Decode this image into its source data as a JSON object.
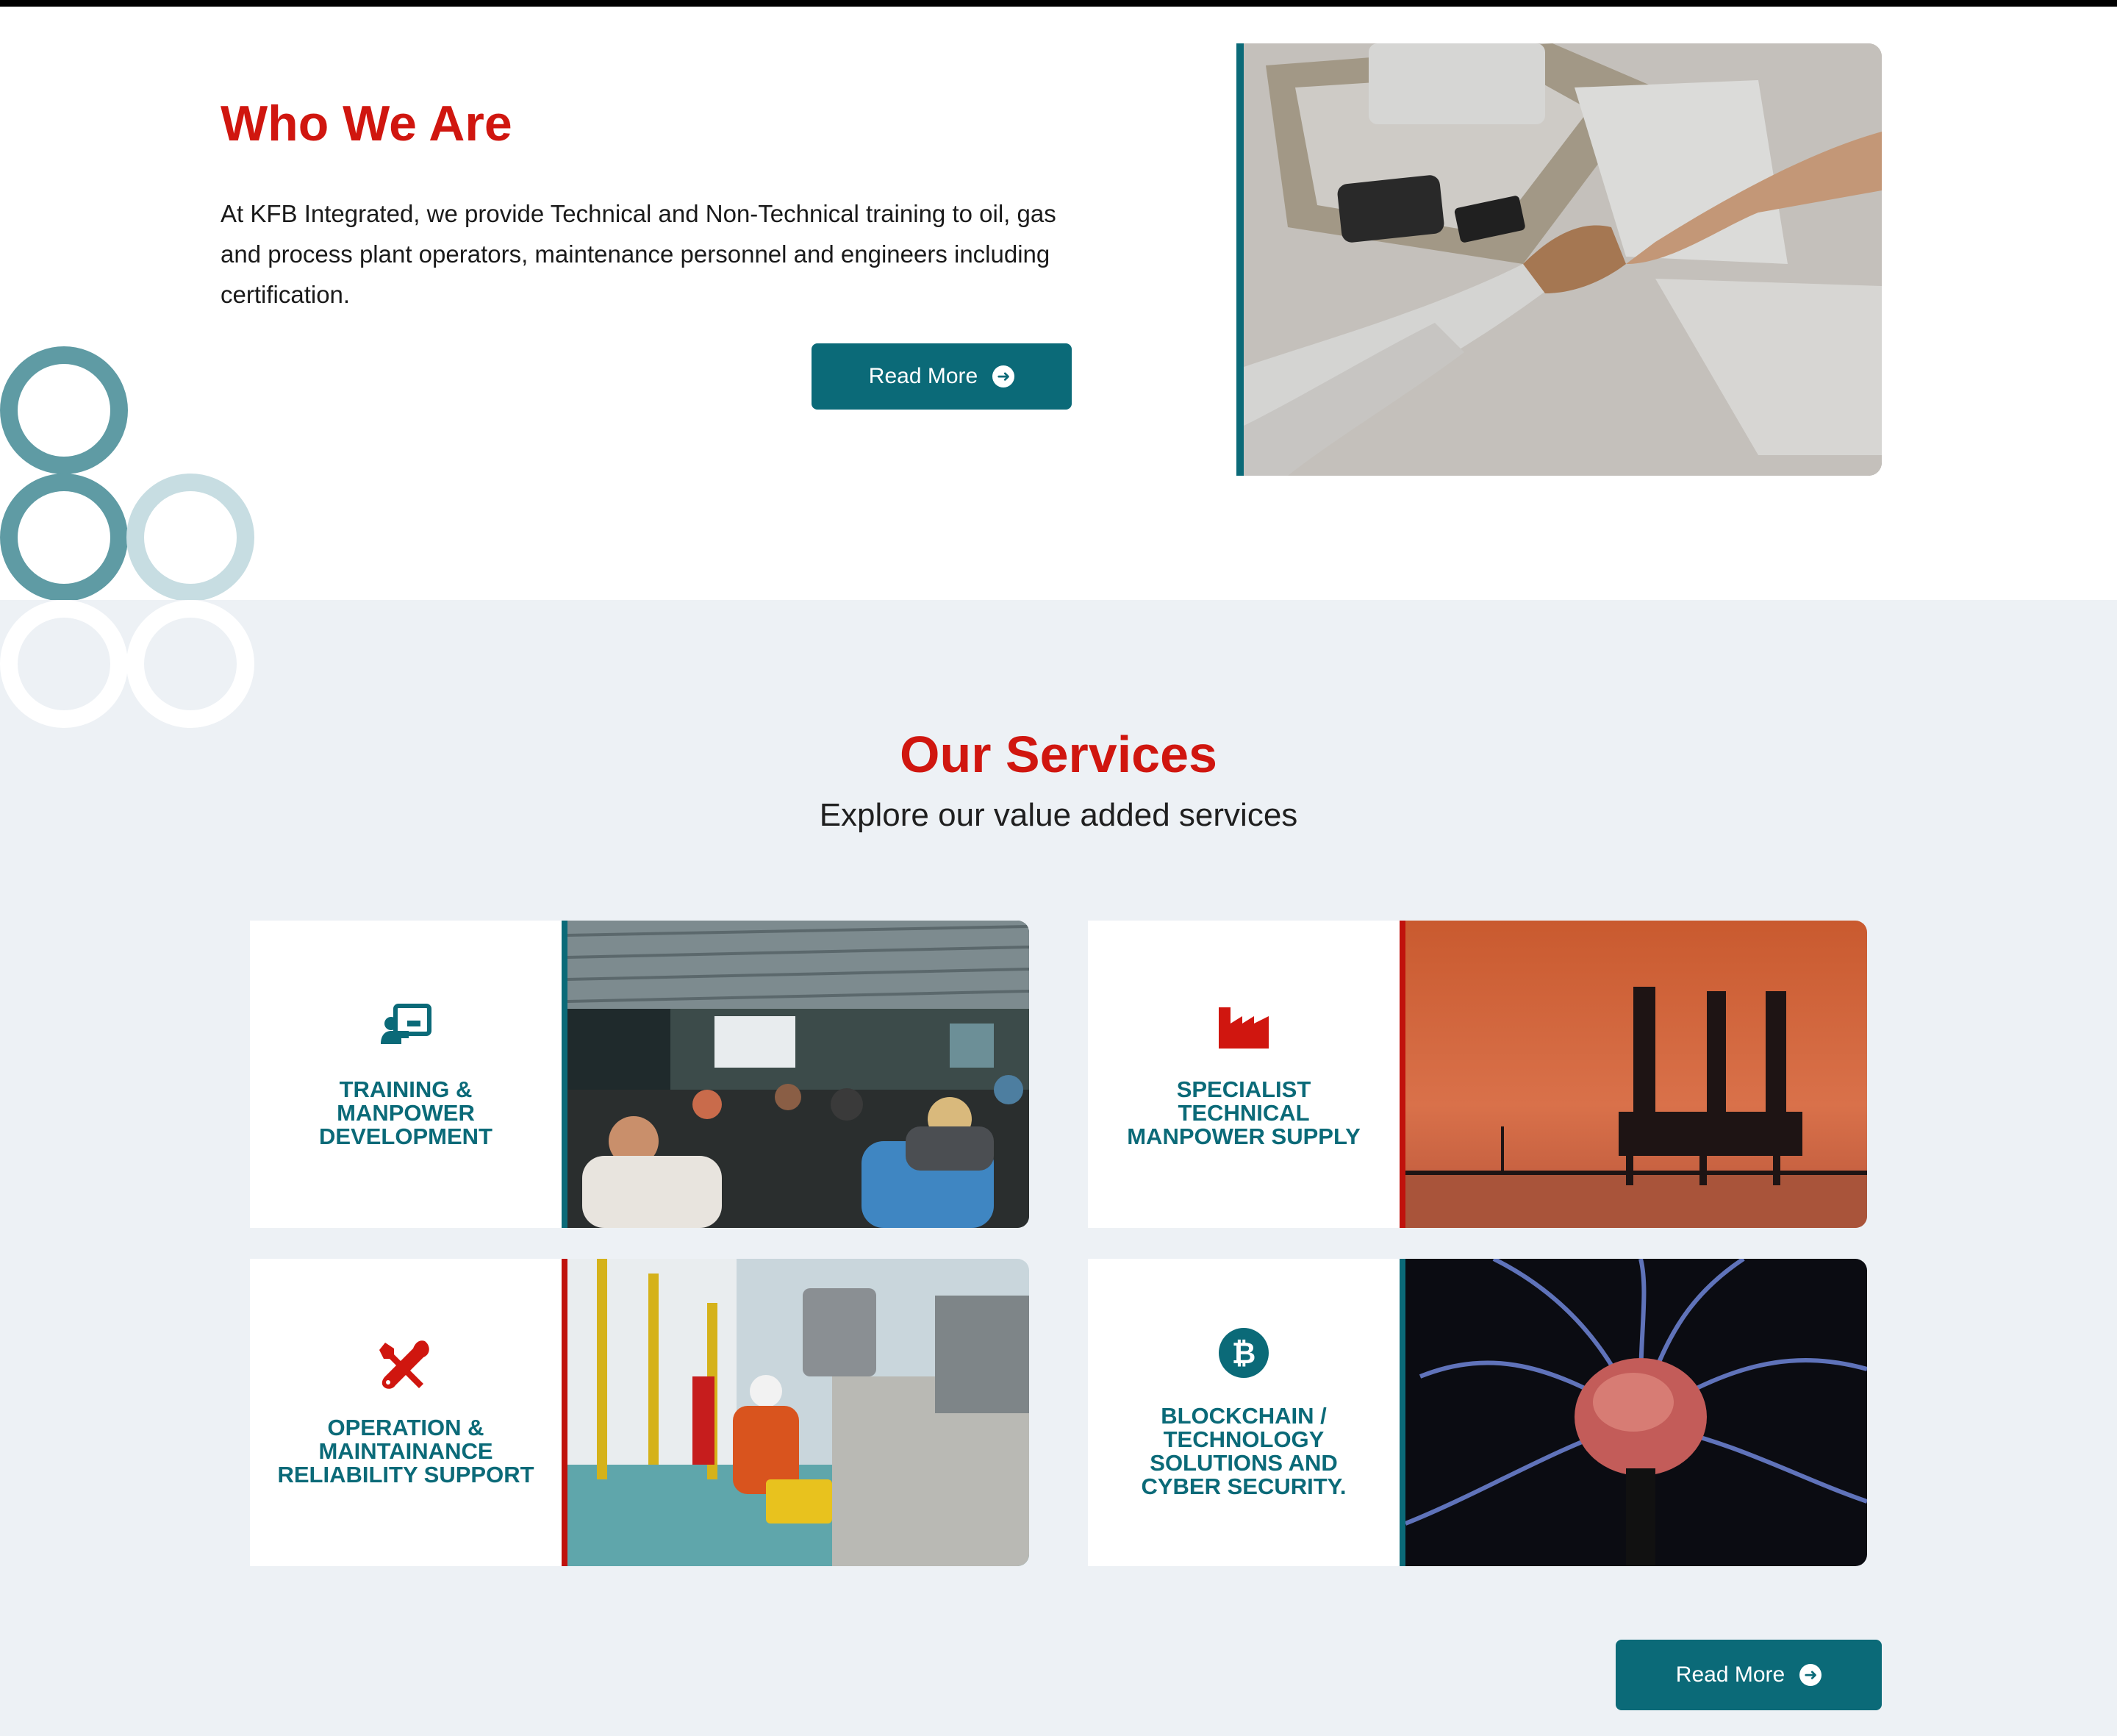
{
  "who": {
    "title": "Who We Are",
    "body": "At KFB Integrated, we provide Technical and Non-Technical training to oil, gas and process plant operators, maintenance personnel and engineers including certification.",
    "button_label": "Read More"
  },
  "services": {
    "title": "Our Services",
    "subtitle": "Explore our value added services",
    "button_label": "Read More",
    "cards": [
      {
        "label": "TRAINING & MANPOWER DEVELOPMENT",
        "icon": "presentation-icon",
        "accent": "#0b6a78"
      },
      {
        "label": "SPECIALIST TECHNICAL MANPOWER SUPPLY",
        "icon": "factory-icon",
        "accent": "#c0120c"
      },
      {
        "label": "OPERATION & MAINTAINANCE RELIABILITY SUPPORT",
        "icon": "tools-icon",
        "accent": "#c0120c"
      },
      {
        "label": "BLOCKCHAIN / TECHNOLOGY SOLUTIONS AND CYBER SECURITY.",
        "icon": "bitcoin-icon",
        "accent": "#0b6a78"
      }
    ]
  },
  "colors": {
    "brand_teal": "#0b6a78",
    "brand_red": "#d0160f",
    "services_bg": "#edf1f5"
  }
}
